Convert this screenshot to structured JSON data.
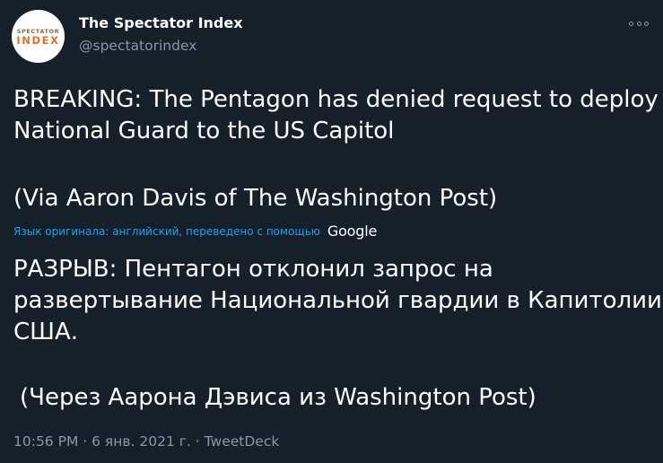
{
  "author": {
    "avatar_top": "SPECTATOR",
    "avatar_bottom": "INDEX",
    "name": "The Spectator Index",
    "handle": "@spectatorindex"
  },
  "tweet": {
    "lines": [
      "BREAKING: The Pentagon has denied request to deploy",
      "National Guard to the US Capitol",
      "(Via Aaron Davis of The Washington Post)"
    ],
    "translation_note": "Язык оригинала: английский, переведено с помощью",
    "translation_provider": "Google",
    "translated_lines": [
      "РАЗРЫВ: Пентагон отклонил запрос на",
      "развертывание Национальной гвардии в Капитолии",
      "США.",
      "(Через Аарона Дэвиса из Washington Post)"
    ]
  },
  "meta": {
    "time": "10:56 PM",
    "separator1": "·",
    "date": "6 янв. 2021 г.",
    "separator2": "·",
    "source": "TweetDeck"
  },
  "icons": {
    "more": "more-options-icon"
  },
  "colors": {
    "background": "#15202b",
    "text": "#ffffff",
    "secondary": "#8899a6",
    "link": "#1da1f2"
  }
}
